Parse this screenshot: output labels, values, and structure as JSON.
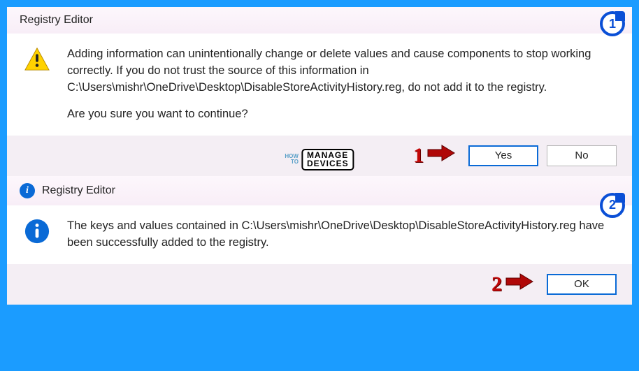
{
  "dialog1": {
    "title": "Registry Editor",
    "message": "Adding information can unintentionally change or delete values and cause components to stop working correctly. If you do not trust the source of this information in C:\\Users\\mishr\\OneDrive\\Desktop\\DisableStoreActivityHistory.reg, do not add it to the registry.",
    "confirm": "Are you sure you want to continue?",
    "yes": "Yes",
    "no": "No"
  },
  "dialog2": {
    "title": "Registry Editor",
    "message": "The keys and values contained in C:\\Users\\mishr\\OneDrive\\Desktop\\DisableStoreActivityHistory.reg have been successfully added to the registry.",
    "ok": "OK"
  },
  "callouts": {
    "one": "1",
    "two": "2"
  },
  "steps": {
    "one": "1",
    "two": "2"
  },
  "watermark": {
    "left_top": "HOW",
    "left_bottom": "TO",
    "right_top": "MANAGE",
    "right_bottom": "DEVICES"
  }
}
